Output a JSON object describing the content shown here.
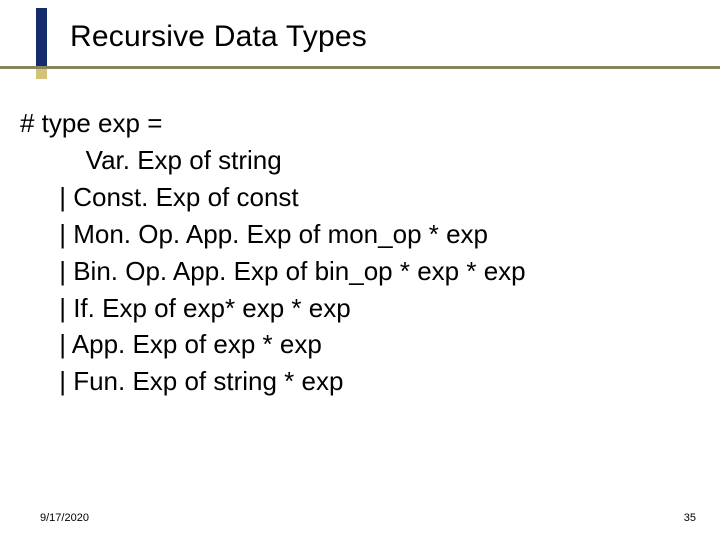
{
  "title": "Recursive Data Types",
  "code": {
    "l0": "# type exp =",
    "l1": "   Var. Exp of string",
    "l2": " | Const. Exp of const",
    "l3": " | Mon. Op. App. Exp of mon_op * exp",
    "l4": " | Bin. Op. App. Exp of bin_op * exp * exp",
    "l5": " | If. Exp of exp* exp * exp",
    "l6": " | App. Exp of exp * exp",
    "l7": " | Fun. Exp of string * exp"
  },
  "footer": {
    "date": "9/17/2020",
    "page": "35"
  }
}
